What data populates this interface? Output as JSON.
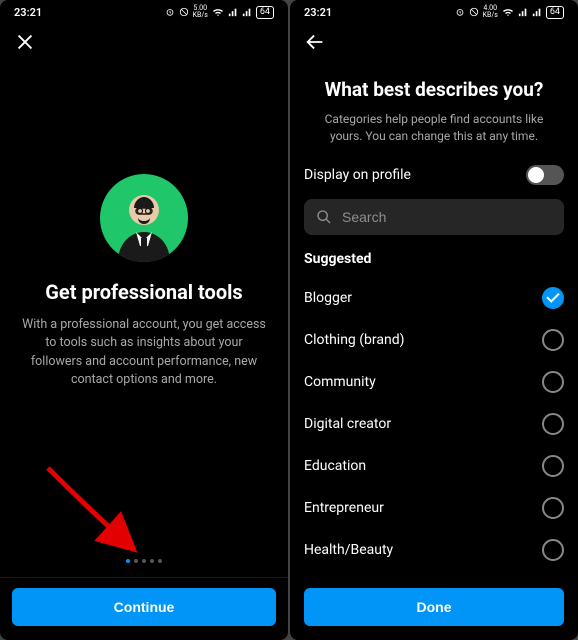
{
  "statusbar": {
    "time": "23:21",
    "net_speed_left": "5.00",
    "net_speed_right": "4.00",
    "net_unit": "KB/s",
    "battery": "64"
  },
  "left": {
    "heading": "Get professional tools",
    "description": "With a professional account, you get access to tools such as insights about your followers and account performance, new contact options and more.",
    "button": "Continue",
    "dots_total": 5,
    "dots_active": 0
  },
  "right": {
    "heading": "What best describes you?",
    "sub": "Categories help people find accounts like yours. You can change this at any time.",
    "display_on_profile_label": "Display on profile",
    "display_on_profile": false,
    "search_placeholder": "Search",
    "section": "Suggested",
    "categories": [
      {
        "label": "Blogger",
        "selected": true
      },
      {
        "label": "Clothing (brand)",
        "selected": false
      },
      {
        "label": "Community",
        "selected": false
      },
      {
        "label": "Digital creator",
        "selected": false
      },
      {
        "label": "Education",
        "selected": false
      },
      {
        "label": "Entrepreneur",
        "selected": false
      },
      {
        "label": "Health/Beauty",
        "selected": false
      }
    ],
    "button": "Done"
  }
}
